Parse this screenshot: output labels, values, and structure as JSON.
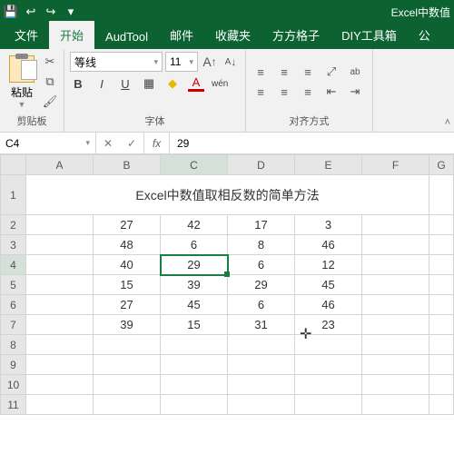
{
  "titlebar": {
    "title": "Excel中数值"
  },
  "tabs": {
    "file": "文件",
    "home": "开始",
    "audtool": "AudTool",
    "mail": "邮件",
    "fav": "收藏夹",
    "square": "方方格子",
    "diy": "DIY工具箱",
    "pub": "公"
  },
  "ribbon": {
    "clipboard": {
      "paste": "粘贴",
      "label": "剪贴板"
    },
    "font": {
      "name": "等线",
      "size": "11",
      "grow": "A",
      "shrink": "A",
      "bold": "B",
      "italic": "I",
      "underline": "U",
      "border": "▦",
      "fill": "◆",
      "color": "A",
      "ruby": "wén",
      "label": "字体"
    },
    "align": {
      "label": "对齐方式",
      "wrap": "ab"
    }
  },
  "namebox": {
    "ref": "C4"
  },
  "formula": {
    "fx": "fx",
    "value": "29"
  },
  "columns": [
    "",
    "A",
    "B",
    "C",
    "D",
    "E",
    "F",
    "G"
  ],
  "title_row": "Excel中数值取相反数的简单方法",
  "data": [
    [
      "27",
      "42",
      "17",
      "3"
    ],
    [
      "48",
      "6",
      "8",
      "46"
    ],
    [
      "40",
      "29",
      "6",
      "12"
    ],
    [
      "15",
      "39",
      "29",
      "45"
    ],
    [
      "27",
      "45",
      "6",
      "46"
    ],
    [
      "39",
      "15",
      "31",
      "23"
    ]
  ],
  "cursor": {
    "glyph": "✛"
  }
}
